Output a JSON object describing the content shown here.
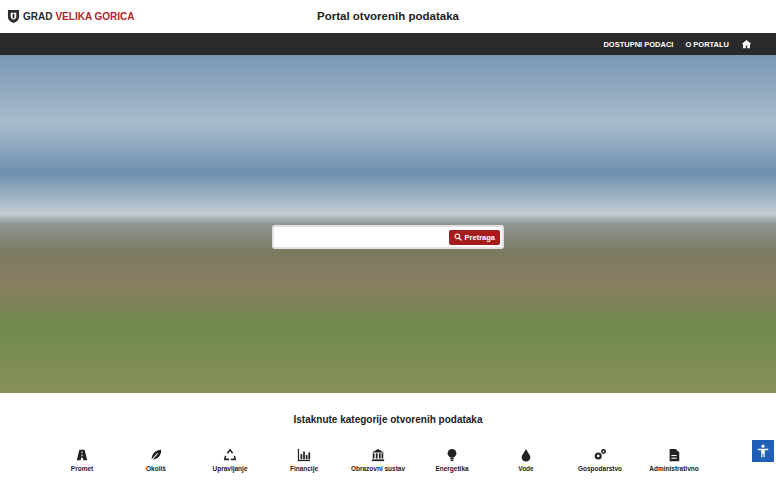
{
  "header": {
    "logo": {
      "prefix": "GRAD",
      "name": "VELIKA GORICA"
    },
    "title": "Portal otvorenih podataka"
  },
  "nav": {
    "items": [
      {
        "label": "DOSTUPNI PODACI",
        "selected": false
      },
      {
        "label": "O PORTALU",
        "selected": false
      }
    ]
  },
  "search": {
    "placeholder": "",
    "button": "Pretraga"
  },
  "categories": {
    "title": "Istaknute kategorije otvorenih podataka",
    "items": [
      {
        "label": "Promet",
        "icon": "car"
      },
      {
        "label": "Okoliš",
        "icon": "leaf"
      },
      {
        "label": "Upravljanje",
        "icon": "recycle"
      },
      {
        "label": "Financije",
        "icon": "chart"
      },
      {
        "label": "Obrazovni sustav",
        "icon": "bank"
      },
      {
        "label": "Energetika",
        "icon": "bulb"
      },
      {
        "label": "Vode",
        "icon": "drop"
      },
      {
        "label": "Gospodarstvo",
        "icon": "gears"
      },
      {
        "label": "Administrativno",
        "icon": "doc"
      }
    ]
  }
}
